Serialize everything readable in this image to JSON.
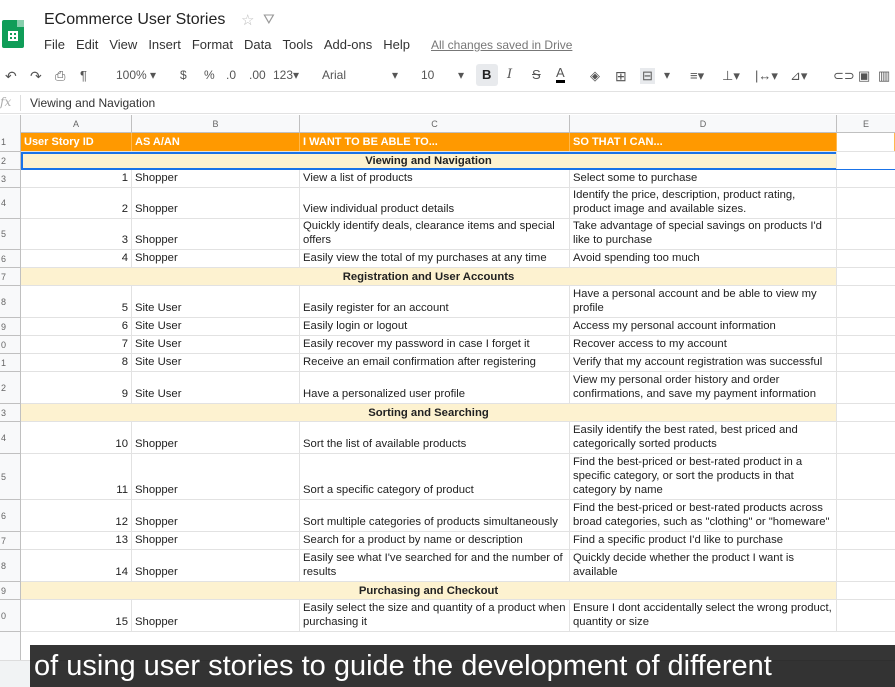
{
  "app": {
    "doc_title": "ECommerce User Stories",
    "menu": [
      "File",
      "Edit",
      "View",
      "Insert",
      "Format",
      "Data",
      "Tools",
      "Add-ons",
      "Help"
    ],
    "saved_status": "All changes saved in Drive"
  },
  "toolbar": {
    "zoom": "100%",
    "currency": "$",
    "percent": "%",
    "dec_less": ".0",
    "dec_more": ".00",
    "format_more": "123",
    "font": "Arial",
    "font_size": "10",
    "bold": "B",
    "italic": "I",
    "strike": "S",
    "text_color": "A"
  },
  "formula_bar": {
    "fx": "fx",
    "value": "Viewing and Navigation"
  },
  "columns": [
    "A",
    "B",
    "C",
    "D",
    "E"
  ],
  "header": {
    "a": "User Story ID",
    "b": "AS A/AN",
    "c": "I WANT TO BE ABLE TO...",
    "d": "SO THAT I CAN..."
  },
  "rows": [
    {
      "num": "2",
      "section": "Viewing and Navigation"
    },
    {
      "num": "3",
      "id": "1",
      "role": "Shopper",
      "want": "View a list of products",
      "so": "Select some to purchase"
    },
    {
      "num": "4",
      "id": "2",
      "role": "Shopper",
      "want": "View individual product details",
      "so": "Identify the price, description, product rating, product image and available sizes."
    },
    {
      "num": "5",
      "id": "3",
      "role": "Shopper",
      "want": "Quickly identify deals, clearance items and special offers",
      "so": "Take advantage of special savings on products I'd like to purchase"
    },
    {
      "num": "6",
      "id": "4",
      "role": "Shopper",
      "want": "Easily view the total of my purchases at any time",
      "so": "Avoid spending too much"
    },
    {
      "num": "7",
      "section": "Registration and User Accounts"
    },
    {
      "num": "8",
      "id": "5",
      "role": "Site User",
      "want": "Easily register for an account",
      "so": "Have a personal account and be able to view my profile"
    },
    {
      "num": "9",
      "id": "6",
      "role": "Site User",
      "want": "Easily login or logout",
      "so": "Access my personal account information"
    },
    {
      "num": "0",
      "id": "7",
      "role": "Site User",
      "want": "Easily recover my password in case I forget it",
      "so": "Recover access to my account"
    },
    {
      "num": "1",
      "id": "8",
      "role": "Site User",
      "want": "Receive an email confirmation after registering",
      "so": "Verify that my account registration was successful"
    },
    {
      "num": "2",
      "id": "9",
      "role": "Site User",
      "want": "Have a personalized user profile",
      "so": "View my personal order history and order confirmations, and save my payment information"
    },
    {
      "num": "3",
      "section": "Sorting and Searching"
    },
    {
      "num": "4",
      "id": "10",
      "role": "Shopper",
      "want": "Sort the list of available products",
      "so": "Easily identify the best rated, best priced and categorically sorted products"
    },
    {
      "num": "5",
      "id": "11",
      "role": "Shopper",
      "want": "Sort a specific category of product",
      "so": "Find the best-priced or best-rated product in a specific category, or sort the products in that category by name"
    },
    {
      "num": "6",
      "id": "12",
      "role": "Shopper",
      "want": "Sort multiple categories of products simultaneously",
      "so": "Find the best-priced or best-rated products across broad categories, such as \"clothing\" or \"homeware\""
    },
    {
      "num": "7",
      "id": "13",
      "role": "Shopper",
      "want": "Search for a product by name or description",
      "so": "Find a specific product I'd like to purchase"
    },
    {
      "num": "8",
      "id": "14",
      "role": "Shopper",
      "want": "Easily see what I've searched for and the number of results",
      "so": "Quickly decide whether the product I want is available"
    },
    {
      "num": "9",
      "section": "Purchasing and Checkout"
    },
    {
      "num": "0",
      "id": "15",
      "role": "Shopper",
      "want": "Easily select the size and quantity of a product when purchasing it",
      "so": "Ensure I dont accidentally select the wrong product, quantity or size"
    }
  ],
  "caption": "of using user stories to guide the development of different"
}
